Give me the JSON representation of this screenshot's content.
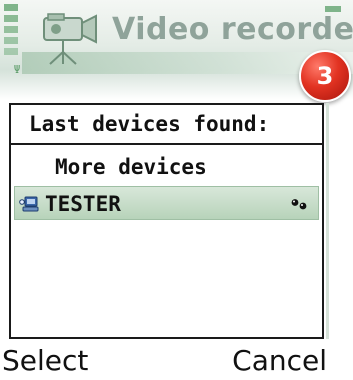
{
  "header": {
    "app_title": "Video recorder",
    "app_icon": "video-camera-icon"
  },
  "badge": {
    "number": "3",
    "color": "#d92a1c"
  },
  "list": {
    "heading": "Last devices found:",
    "items": [
      {
        "label": "More devices",
        "selected": false
      },
      {
        "label": "TESTER",
        "selected": true,
        "icon": "bluetooth-device-icon",
        "status_icon": "paired-icon"
      }
    ]
  },
  "softkeys": {
    "left": "Select",
    "right": "Cancel"
  },
  "colors": {
    "selection": "#b7d3ba",
    "accent": "#7fb48a"
  }
}
